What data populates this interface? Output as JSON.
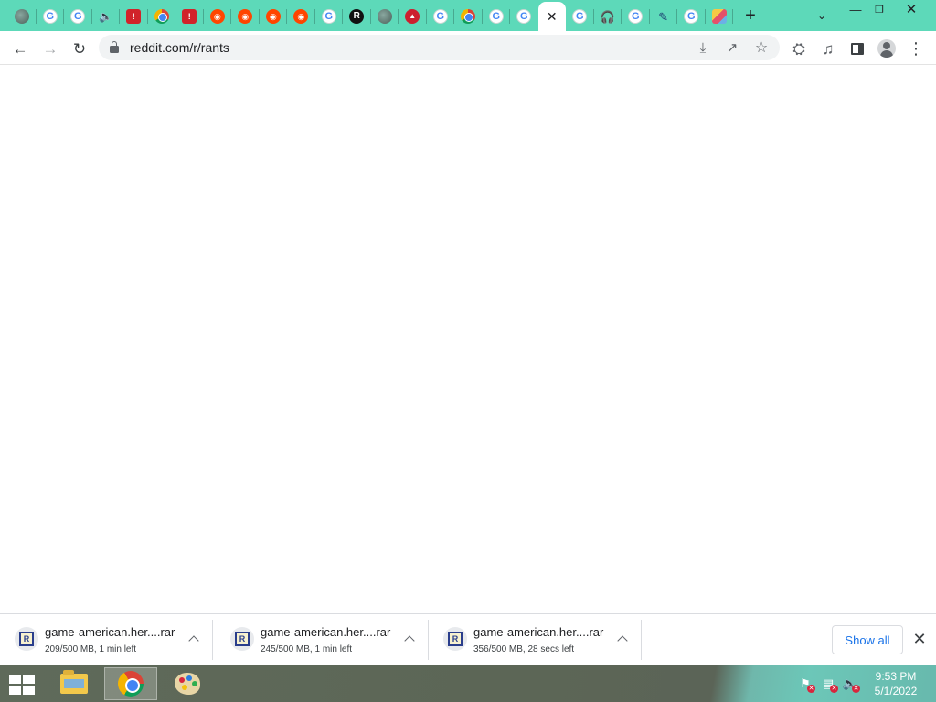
{
  "browser": {
    "tabs": [
      {
        "icon": "globe-icon",
        "active": false
      },
      {
        "icon": "google-icon",
        "active": false
      },
      {
        "icon": "google-icon",
        "active": false
      },
      {
        "icon": "audio-icon",
        "active": false
      },
      {
        "icon": "red-app-icon",
        "active": false
      },
      {
        "icon": "chrome-icon",
        "active": false
      },
      {
        "icon": "red-app-icon",
        "active": false
      },
      {
        "icon": "reddit-icon",
        "active": false
      },
      {
        "icon": "reddit-icon",
        "active": false
      },
      {
        "icon": "reddit-icon",
        "active": false
      },
      {
        "icon": "reddit-icon",
        "active": false
      },
      {
        "icon": "google-icon",
        "active": false
      },
      {
        "icon": "r-logo-icon",
        "active": false
      },
      {
        "icon": "globe-icon",
        "active": false
      },
      {
        "icon": "red-circle-icon",
        "active": false
      },
      {
        "icon": "google-icon",
        "active": false
      },
      {
        "icon": "chrome-icon",
        "active": false
      },
      {
        "icon": "google-icon",
        "active": false
      },
      {
        "icon": "google-icon",
        "active": false
      },
      {
        "icon": "close-icon",
        "active": true
      },
      {
        "icon": "google-icon",
        "active": false
      },
      {
        "icon": "headphones-icon",
        "active": false
      },
      {
        "icon": "google-icon",
        "active": false
      },
      {
        "icon": "pen-icon",
        "active": false
      },
      {
        "icon": "google-icon",
        "active": false
      },
      {
        "icon": "image-icon",
        "active": false
      }
    ],
    "new_tab_label": "+",
    "address": {
      "url": "reddit.com/r/rants"
    }
  },
  "downloads": {
    "items": [
      {
        "name": "game-american.her....rar",
        "status": "209/500 MB, 1 min left",
        "progress": 0.418
      },
      {
        "name": "game-american.her....rar",
        "status": "245/500 MB, 1 min left",
        "progress": 0.49
      },
      {
        "name": "game-american.her....rar",
        "status": "356/500 MB, 28 secs left",
        "progress": 0.712
      }
    ],
    "show_all_label": "Show all"
  },
  "taskbar": {
    "apps": [
      "file-explorer",
      "chrome",
      "paint"
    ],
    "active_app": "chrome",
    "time": "9:53 PM",
    "date": "5/1/2022"
  },
  "colors": {
    "tabstrip": "#5dd9b9",
    "link_blue": "#1a73e8"
  }
}
